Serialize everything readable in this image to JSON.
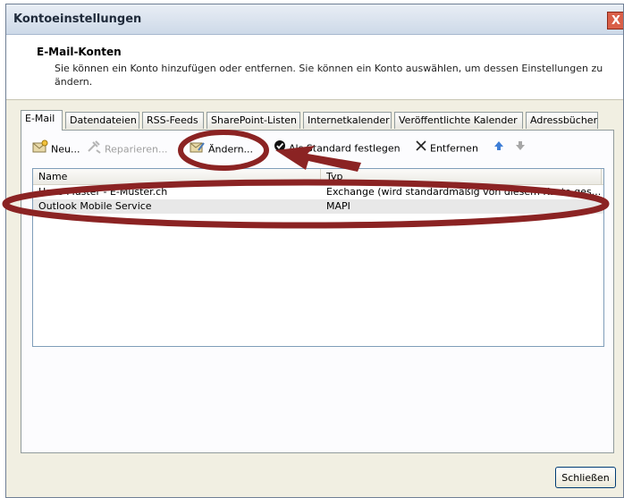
{
  "window": {
    "title": "Kontoeinstellungen",
    "close_glyph": "X"
  },
  "header": {
    "title": "E-Mail-Konten",
    "description": "Sie können ein Konto hinzufügen oder entfernen. Sie können ein Konto auswählen, um dessen Einstellungen zu ändern."
  },
  "tabs": [
    {
      "label": "E-Mail",
      "active": true
    },
    {
      "label": "Datendateien",
      "active": false
    },
    {
      "label": "RSS-Feeds",
      "active": false
    },
    {
      "label": "SharePoint-Listen",
      "active": false
    },
    {
      "label": "Internetkalender",
      "active": false
    },
    {
      "label": "Veröffentlichte Kalender",
      "active": false
    },
    {
      "label": "Adressbücher",
      "active": false
    }
  ],
  "toolbar": {
    "new_label": "Neu...",
    "repair_label": "Reparieren...",
    "change_label": "Ändern...",
    "set_default_label": "Als Standard festlegen",
    "remove_label": "Entfernen",
    "move_up_icon": "arrow-up-icon",
    "move_down_icon": "arrow-down-icon"
  },
  "account_list": {
    "columns": [
      "Name",
      "Typ"
    ],
    "rows": [
      {
        "name": "Hans Muster - E-Muster.ch",
        "type": "Exchange (wird standardmäßig von diesem Konto ges..."
      },
      {
        "name": "Outlook Mobile Service",
        "type": "MAPI"
      }
    ]
  },
  "footer": {
    "close_label": "Schließen"
  },
  "colors": {
    "annotation": "#8b2323",
    "selected_row": "#e8e8e8"
  }
}
